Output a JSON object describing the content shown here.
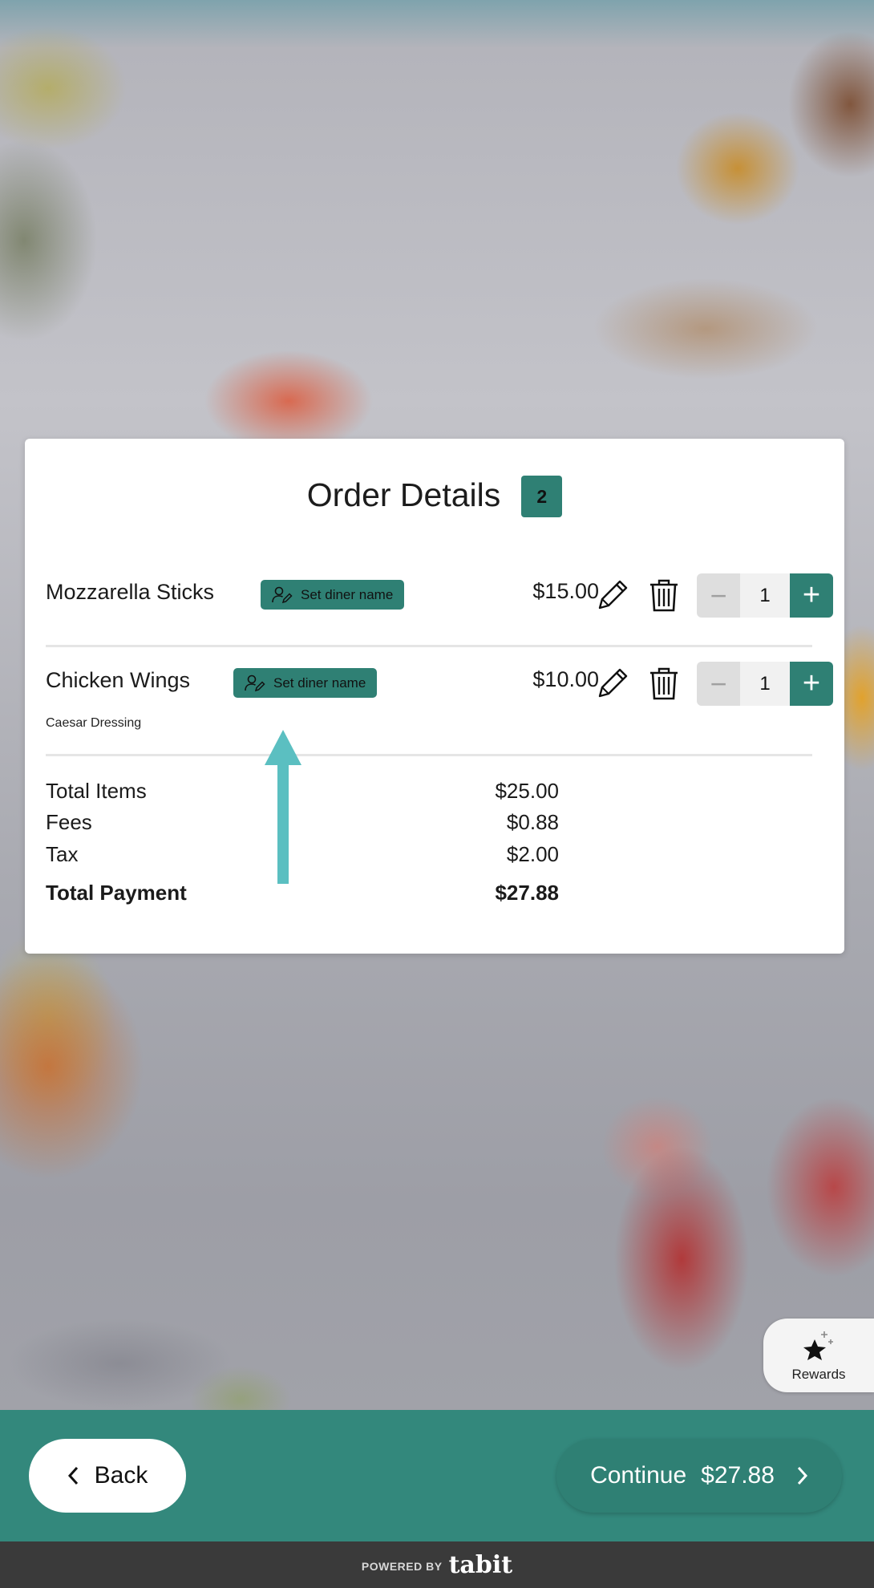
{
  "order": {
    "title": "Order Details",
    "count": "2",
    "items": [
      {
        "name": "Mozzarella Sticks",
        "diner_button": "Set diner name",
        "price": "$15.00",
        "quantity": "1",
        "note": ""
      },
      {
        "name": "Chicken Wings",
        "diner_button": "Set diner name",
        "price": "$10.00",
        "quantity": "1",
        "note": "Caesar Dressing"
      }
    ],
    "summary": {
      "total_items_label": "Total Items",
      "total_items_value": "$25.00",
      "fees_label": "Fees",
      "fees_value": "$0.88",
      "tax_label": "Tax",
      "tax_value": "$2.00",
      "total_payment_label": "Total Payment",
      "total_payment_value": "$27.88"
    }
  },
  "stepper": {
    "minus": "−",
    "plus": "+"
  },
  "rewards": {
    "label": "Rewards",
    "icon": "star-sparkle-icon"
  },
  "bottom_bar": {
    "back_label": "Back",
    "continue_label": "Continue",
    "continue_amount": "$27.88"
  },
  "footer": {
    "powered_by": "POWERED BY",
    "brand": "tabit"
  },
  "colors": {
    "primary": "#2f8074",
    "bar": "#33887c",
    "annotation_arrow": "#5bbfc1"
  }
}
